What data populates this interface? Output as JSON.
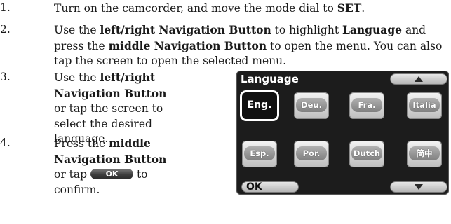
{
  "steps": [
    {
      "number": "1.",
      "parts": [
        "Turn on the camcorder, and move the mode dial to ",
        "SET",
        "."
      ]
    },
    {
      "number": "2.",
      "parts": [
        "Use the ",
        "left/right Navigation Button",
        " to highlight ",
        "Language",
        " and press the ",
        "middle Navigation Button",
        " to open the menu. You can also tap the screen to open the selected menu."
      ]
    },
    {
      "number": "3.",
      "parts": [
        "Use the ",
        "left/right Navigation Button",
        " or tap the screen to select the desired language."
      ]
    },
    {
      "number": "4.",
      "parts": [
        "Press the ",
        "middle Navigation Button",
        " or tap ",
        "to confirm."
      ],
      "inline_button": "OK"
    }
  ],
  "screen": {
    "title": "Language",
    "ok_label": "OK",
    "languages": [
      "Eng.",
      "Deu.",
      "Fra.",
      "Italia",
      "Esp.",
      "Por.",
      "Dutch",
      "简中"
    ],
    "selected": "Eng.",
    "up_icon": "triangle-up-icon",
    "down_icon": "triangle-down-icon"
  }
}
